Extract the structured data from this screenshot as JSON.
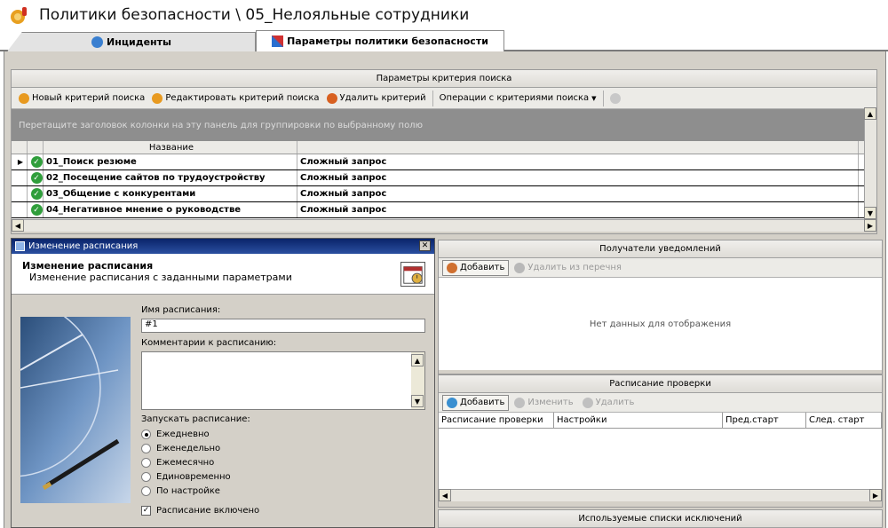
{
  "window": {
    "title": "Политики безопасности \\ 05_Нелояльные сотрудники",
    "title_icon": "policy-icon"
  },
  "tabs": [
    {
      "label": "Инциденты",
      "icon": "database-icon",
      "active": false
    },
    {
      "label": "Параметры политики безопасности",
      "icon": "tools-icon",
      "active": true
    }
  ],
  "criteria": {
    "header": "Параметры критерия поиска",
    "toolbar": {
      "new": "Новый критерий поиска",
      "edit": "Редактировать критерий поиска",
      "delete": "Удалить критерий",
      "ops": "Операции с критериями поиска"
    },
    "group_hint": "Перетащите заголовок колонки на эту панель для группировки по выбранному полю",
    "columns": {
      "name": "Название"
    },
    "rows": [
      {
        "name": "01_Поиск резюме",
        "type": "Сложный запрос"
      },
      {
        "name": "02_Посещение сайтов по трудоустройству",
        "type": "Сложный запрос"
      },
      {
        "name": "03_Общение с конкурентами",
        "type": "Сложный запрос"
      },
      {
        "name": "04_Негативное мнение о руководстве",
        "type": "Сложный запрос"
      }
    ]
  },
  "dialog": {
    "title": "Изменение расписания",
    "heading": "Изменение расписания",
    "subheading": "Изменение расписания с заданными параметрами",
    "name_label": "Имя расписания:",
    "name_value": "#1",
    "comment_label": "Комментарии к расписанию:",
    "comment_value": "",
    "run_label": "Запускать расписание:",
    "options": [
      "Ежедневно",
      "Еженедельно",
      "Ежемесячно",
      "Единовременно",
      "По настройке"
    ],
    "selected_option": "Ежедневно",
    "enabled_label": "Расписание включено",
    "enabled": true
  },
  "recipients": {
    "header": "Получатели уведомлений",
    "add": "Добавить",
    "remove": "Удалить из перечня",
    "empty": "Нет данных для отображения"
  },
  "schedule": {
    "header": "Расписание проверки",
    "add": "Добавить",
    "edit": "Изменить",
    "delete": "Удалить",
    "columns": [
      "Расписание проверки",
      "Настройки",
      "Пред.старт",
      "След. старт"
    ]
  },
  "exclusions": {
    "header": "Используемые списки исключений"
  }
}
